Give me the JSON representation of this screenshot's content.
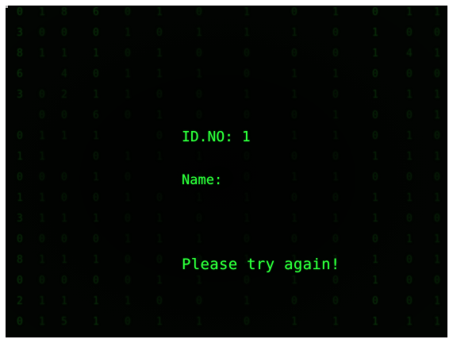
{
  "terminal": {
    "id_label": "ID.NO:",
    "id_value": "1",
    "name_label": "Name:",
    "name_value": "",
    "message": "Please try again!"
  },
  "background": {
    "style": "matrix-digital-rain",
    "rain_color": "#0c4a0c",
    "text_color": "#2cff3a",
    "screen_color": "#020502"
  }
}
